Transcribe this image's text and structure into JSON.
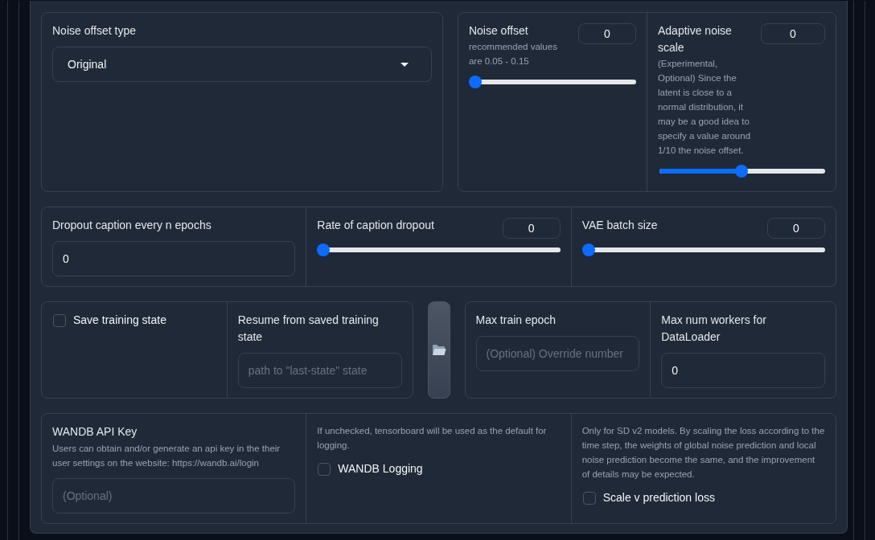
{
  "panel": {
    "rows": [
      {
        "groups": [
          {
            "kind": "card",
            "cells": [
              {
                "kind": "dropdown",
                "label": "Noise offset type",
                "value": "Original"
              }
            ]
          },
          {
            "kind": "card",
            "cells": [
              {
                "kind": "slider",
                "label": "Noise offset",
                "info": "recommended values are 0.05 - 0.15",
                "value": "0",
                "level": 0
              },
              {
                "kind": "slider",
                "label": "Adaptive noise scale",
                "info": "(Experimental, Optional) Since the latent is close to a normal distribution, it may be a good idea to specify a value around 1/10 the noise offset.",
                "value": "0",
                "level": 0.5
              }
            ]
          }
        ]
      },
      {
        "groups": [
          {
            "kind": "card",
            "cells": [
              {
                "kind": "textbox",
                "label": "Dropout caption every n epochs",
                "value": "0"
              },
              {
                "kind": "slider",
                "label": "Rate of caption dropout",
                "value": "0",
                "level": 0
              },
              {
                "kind": "slider",
                "label": "VAE batch size",
                "value": "0",
                "level": 0
              }
            ]
          }
        ]
      },
      {
        "groups": [
          {
            "kind": "card",
            "cells": [
              {
                "kind": "checkbox",
                "label": "Save training state",
                "checked": false
              },
              {
                "kind": "textbox",
                "label": "Resume from saved training state",
                "placeholder": "path to \"last-state\" state"
              }
            ]
          },
          {
            "kind": "folder_button"
          },
          {
            "kind": "card",
            "cells": [
              {
                "kind": "textbox",
                "label": "Max train epoch",
                "placeholder": "(Optional) Override number"
              },
              {
                "kind": "textbox",
                "label": "Max num workers for DataLoader",
                "value": "0"
              }
            ]
          }
        ]
      },
      {
        "groups": [
          {
            "kind": "card",
            "cells": [
              {
                "kind": "textbox",
                "label": "WANDB API Key",
                "info": "Users can obtain and/or generate an api key in the their user settings on the website: https://wandb.ai/login",
                "placeholder": "(Optional)"
              },
              {
                "kind": "checkbox",
                "info": "If unchecked, tensorboard will be used as the default for logging.",
                "label": "WANDB Logging",
                "checked": false
              },
              {
                "kind": "checkbox",
                "info": "Only for SD v2 models. By scaling the loss according to the time step, the weights of global noise prediction and local noise prediction become the same, and the improvement of details may be expected.",
                "label": "Scale v prediction loss",
                "checked": false
              }
            ]
          }
        ]
      }
    ]
  }
}
